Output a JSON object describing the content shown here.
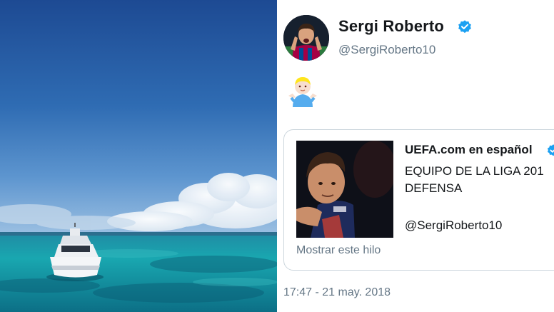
{
  "tweet": {
    "display_name": "Sergi Roberto",
    "handle": "@SergiRoberto10",
    "avatar_icon": "profile-photo",
    "verified_icon": "verified-badge-icon",
    "body_emoji_icon": "person-shrugging-emoji",
    "timestamp": "17:47 - 21 may. 2018"
  },
  "quoted": {
    "name": "UEFA.com en español",
    "line1": "EQUIPO DE LA LIGA 201",
    "line2": "DEFENSA",
    "line3": "@SergiRoberto10",
    "show_thread": "Mostrar este hilo"
  },
  "colors": {
    "verified_blue": "#1da1f2",
    "text_primary": "#14171a",
    "text_secondary": "#657786",
    "border": "#ccd6dd"
  }
}
